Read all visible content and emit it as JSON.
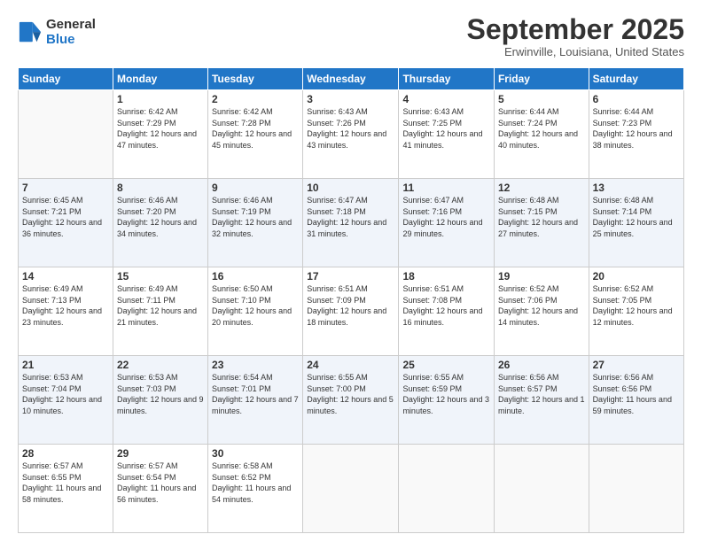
{
  "header": {
    "logo_line1": "General",
    "logo_line2": "Blue",
    "month": "September 2025",
    "location": "Erwinville, Louisiana, United States"
  },
  "days_of_week": [
    "Sunday",
    "Monday",
    "Tuesday",
    "Wednesday",
    "Thursday",
    "Friday",
    "Saturday"
  ],
  "weeks": [
    [
      {
        "day": "",
        "sunrise": "",
        "sunset": "",
        "daylight": ""
      },
      {
        "day": "1",
        "sunrise": "Sunrise: 6:42 AM",
        "sunset": "Sunset: 7:29 PM",
        "daylight": "Daylight: 12 hours and 47 minutes."
      },
      {
        "day": "2",
        "sunrise": "Sunrise: 6:42 AM",
        "sunset": "Sunset: 7:28 PM",
        "daylight": "Daylight: 12 hours and 45 minutes."
      },
      {
        "day": "3",
        "sunrise": "Sunrise: 6:43 AM",
        "sunset": "Sunset: 7:26 PM",
        "daylight": "Daylight: 12 hours and 43 minutes."
      },
      {
        "day": "4",
        "sunrise": "Sunrise: 6:43 AM",
        "sunset": "Sunset: 7:25 PM",
        "daylight": "Daylight: 12 hours and 41 minutes."
      },
      {
        "day": "5",
        "sunrise": "Sunrise: 6:44 AM",
        "sunset": "Sunset: 7:24 PM",
        "daylight": "Daylight: 12 hours and 40 minutes."
      },
      {
        "day": "6",
        "sunrise": "Sunrise: 6:44 AM",
        "sunset": "Sunset: 7:23 PM",
        "daylight": "Daylight: 12 hours and 38 minutes."
      }
    ],
    [
      {
        "day": "7",
        "sunrise": "Sunrise: 6:45 AM",
        "sunset": "Sunset: 7:21 PM",
        "daylight": "Daylight: 12 hours and 36 minutes."
      },
      {
        "day": "8",
        "sunrise": "Sunrise: 6:46 AM",
        "sunset": "Sunset: 7:20 PM",
        "daylight": "Daylight: 12 hours and 34 minutes."
      },
      {
        "day": "9",
        "sunrise": "Sunrise: 6:46 AM",
        "sunset": "Sunset: 7:19 PM",
        "daylight": "Daylight: 12 hours and 32 minutes."
      },
      {
        "day": "10",
        "sunrise": "Sunrise: 6:47 AM",
        "sunset": "Sunset: 7:18 PM",
        "daylight": "Daylight: 12 hours and 31 minutes."
      },
      {
        "day": "11",
        "sunrise": "Sunrise: 6:47 AM",
        "sunset": "Sunset: 7:16 PM",
        "daylight": "Daylight: 12 hours and 29 minutes."
      },
      {
        "day": "12",
        "sunrise": "Sunrise: 6:48 AM",
        "sunset": "Sunset: 7:15 PM",
        "daylight": "Daylight: 12 hours and 27 minutes."
      },
      {
        "day": "13",
        "sunrise": "Sunrise: 6:48 AM",
        "sunset": "Sunset: 7:14 PM",
        "daylight": "Daylight: 12 hours and 25 minutes."
      }
    ],
    [
      {
        "day": "14",
        "sunrise": "Sunrise: 6:49 AM",
        "sunset": "Sunset: 7:13 PM",
        "daylight": "Daylight: 12 hours and 23 minutes."
      },
      {
        "day": "15",
        "sunrise": "Sunrise: 6:49 AM",
        "sunset": "Sunset: 7:11 PM",
        "daylight": "Daylight: 12 hours and 21 minutes."
      },
      {
        "day": "16",
        "sunrise": "Sunrise: 6:50 AM",
        "sunset": "Sunset: 7:10 PM",
        "daylight": "Daylight: 12 hours and 20 minutes."
      },
      {
        "day": "17",
        "sunrise": "Sunrise: 6:51 AM",
        "sunset": "Sunset: 7:09 PM",
        "daylight": "Daylight: 12 hours and 18 minutes."
      },
      {
        "day": "18",
        "sunrise": "Sunrise: 6:51 AM",
        "sunset": "Sunset: 7:08 PM",
        "daylight": "Daylight: 12 hours and 16 minutes."
      },
      {
        "day": "19",
        "sunrise": "Sunrise: 6:52 AM",
        "sunset": "Sunset: 7:06 PM",
        "daylight": "Daylight: 12 hours and 14 minutes."
      },
      {
        "day": "20",
        "sunrise": "Sunrise: 6:52 AM",
        "sunset": "Sunset: 7:05 PM",
        "daylight": "Daylight: 12 hours and 12 minutes."
      }
    ],
    [
      {
        "day": "21",
        "sunrise": "Sunrise: 6:53 AM",
        "sunset": "Sunset: 7:04 PM",
        "daylight": "Daylight: 12 hours and 10 minutes."
      },
      {
        "day": "22",
        "sunrise": "Sunrise: 6:53 AM",
        "sunset": "Sunset: 7:03 PM",
        "daylight": "Daylight: 12 hours and 9 minutes."
      },
      {
        "day": "23",
        "sunrise": "Sunrise: 6:54 AM",
        "sunset": "Sunset: 7:01 PM",
        "daylight": "Daylight: 12 hours and 7 minutes."
      },
      {
        "day": "24",
        "sunrise": "Sunrise: 6:55 AM",
        "sunset": "Sunset: 7:00 PM",
        "daylight": "Daylight: 12 hours and 5 minutes."
      },
      {
        "day": "25",
        "sunrise": "Sunrise: 6:55 AM",
        "sunset": "Sunset: 6:59 PM",
        "daylight": "Daylight: 12 hours and 3 minutes."
      },
      {
        "day": "26",
        "sunrise": "Sunrise: 6:56 AM",
        "sunset": "Sunset: 6:57 PM",
        "daylight": "Daylight: 12 hours and 1 minute."
      },
      {
        "day": "27",
        "sunrise": "Sunrise: 6:56 AM",
        "sunset": "Sunset: 6:56 PM",
        "daylight": "Daylight: 11 hours and 59 minutes."
      }
    ],
    [
      {
        "day": "28",
        "sunrise": "Sunrise: 6:57 AM",
        "sunset": "Sunset: 6:55 PM",
        "daylight": "Daylight: 11 hours and 58 minutes."
      },
      {
        "day": "29",
        "sunrise": "Sunrise: 6:57 AM",
        "sunset": "Sunset: 6:54 PM",
        "daylight": "Daylight: 11 hours and 56 minutes."
      },
      {
        "day": "30",
        "sunrise": "Sunrise: 6:58 AM",
        "sunset": "Sunset: 6:52 PM",
        "daylight": "Daylight: 11 hours and 54 minutes."
      },
      {
        "day": "",
        "sunrise": "",
        "sunset": "",
        "daylight": ""
      },
      {
        "day": "",
        "sunrise": "",
        "sunset": "",
        "daylight": ""
      },
      {
        "day": "",
        "sunrise": "",
        "sunset": "",
        "daylight": ""
      },
      {
        "day": "",
        "sunrise": "",
        "sunset": "",
        "daylight": ""
      }
    ]
  ]
}
